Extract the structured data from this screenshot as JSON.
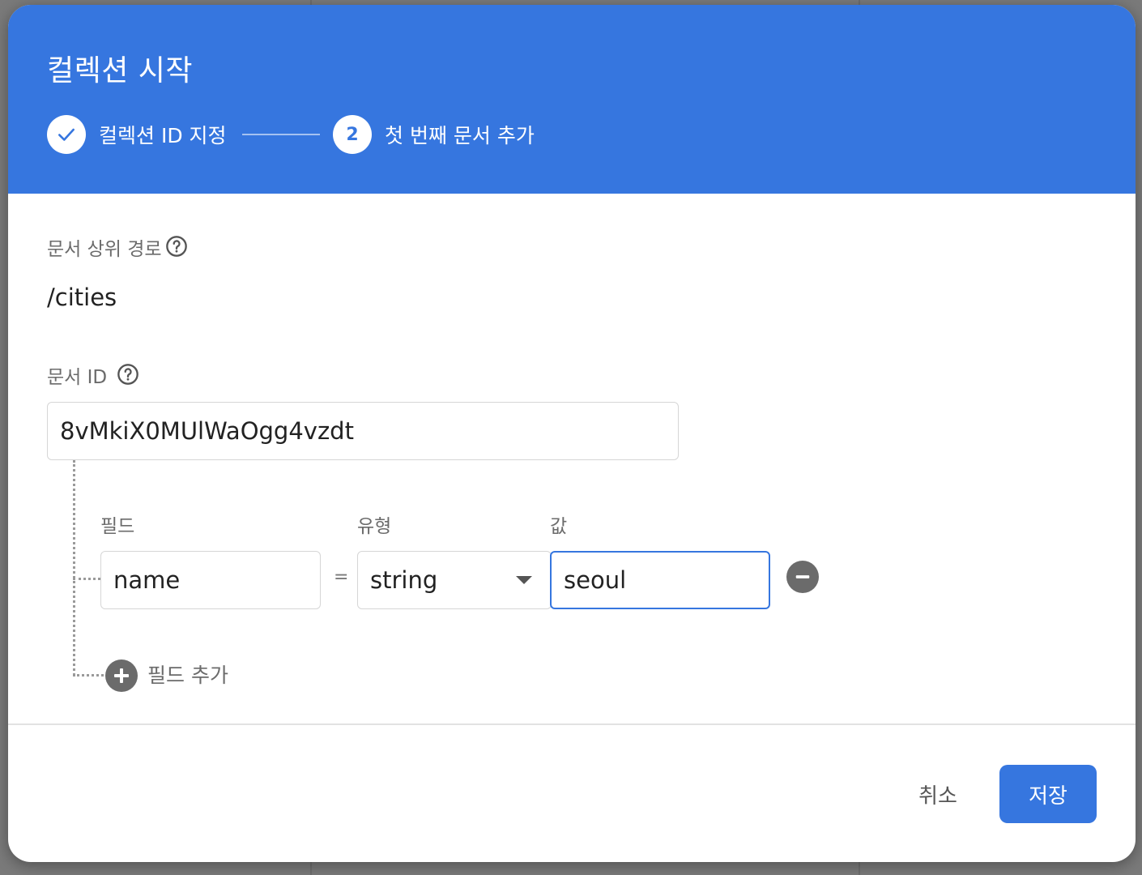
{
  "dialog": {
    "title": "컬렉션 시작",
    "steps": [
      {
        "label": "컬렉션 ID 지정",
        "state": "complete"
      },
      {
        "number": "2",
        "label": "첫 번째 문서 추가",
        "state": "active"
      }
    ]
  },
  "parent_path": {
    "label": "문서 상위 경로",
    "value": "/cities"
  },
  "document_id": {
    "label": "문서 ID",
    "value": "8vMkiX0MUlWaOgg4vzdt"
  },
  "fields": {
    "headers": {
      "field": "필드",
      "type": "유형",
      "value": "값"
    },
    "rows": [
      {
        "field": "name",
        "operator": "=",
        "type": "string",
        "value": "seoul"
      }
    ],
    "add_label": "필드 추가"
  },
  "footer": {
    "cancel_label": "취소",
    "save_label": "저장"
  },
  "colors": {
    "accent": "#3676df",
    "icon_gray": "#6b6b6b"
  }
}
